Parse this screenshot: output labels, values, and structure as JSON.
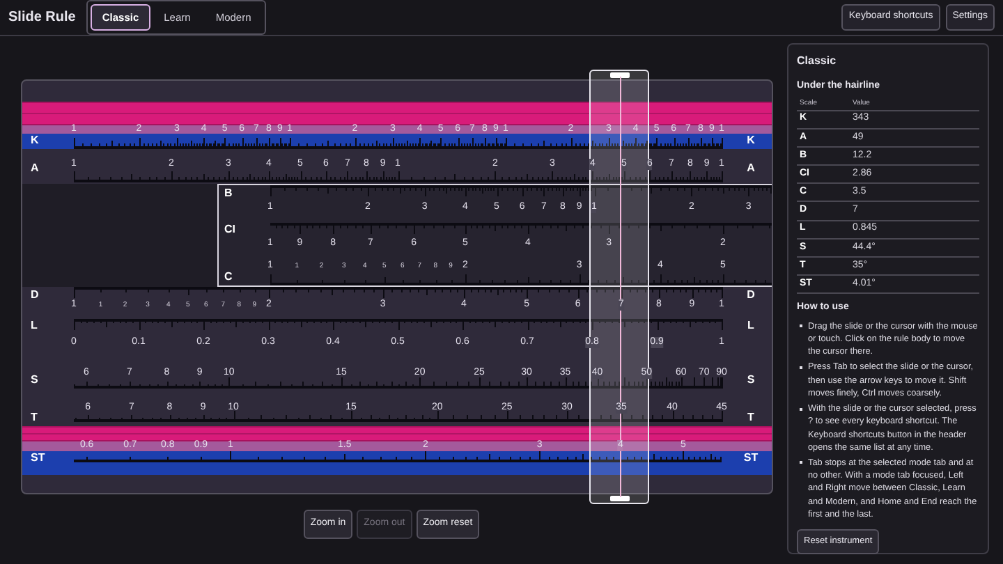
{
  "app": {
    "title": "Slide Rule"
  },
  "mode_tabs": [
    {
      "label": "Classic",
      "selected": true
    },
    {
      "label": "Learn",
      "selected": false
    },
    {
      "label": "Modern",
      "selected": false
    }
  ],
  "header_buttons": [
    "Keyboard shortcuts",
    "Settings"
  ],
  "rule": {
    "stator_top": [
      {
        "name": "K",
        "name_right": "K",
        "kind": "cube",
        "labels": [
          "1",
          "2",
          "3",
          "4",
          "5",
          "6",
          "7",
          "8",
          "9",
          "1",
          "2",
          "3",
          "4",
          "5",
          "6",
          "7",
          "8",
          "9",
          "1",
          "2",
          "3",
          "4",
          "5",
          "6",
          "7",
          "8",
          "9",
          "1"
        ]
      },
      {
        "name": "A",
        "name_right": "A",
        "kind": "square",
        "labels": [
          "1",
          "2",
          "3",
          "4",
          "5",
          "6",
          "7",
          "8",
          "9",
          "1",
          "2",
          "3",
          "4",
          "5",
          "6",
          "7",
          "8",
          "9",
          "1"
        ]
      }
    ],
    "slide": {
      "level": 0.301,
      "scales": [
        {
          "name": "B",
          "kind": "square",
          "labels": [
            "1",
            "2",
            "3",
            "4",
            "5",
            "6",
            "7",
            "8",
            "9",
            "1",
            "2",
            "3"
          ]
        },
        {
          "name": "CI",
          "kind": "inverse",
          "labels": [
            "1",
            "9",
            "8",
            "7",
            "6",
            "5",
            "4",
            "3",
            "2"
          ]
        },
        {
          "name": "C",
          "kind": "single",
          "labels": [
            "1",
            "2",
            "3",
            "4",
            "5"
          ],
          "minor_labels": [
            "1",
            "2",
            "3",
            "4",
            "5",
            "6",
            "7",
            "8",
            "9"
          ]
        }
      ]
    },
    "stator_bottom": [
      {
        "name": "D",
        "name_right": "D",
        "kind": "single",
        "labels": [
          "1",
          "2",
          "3",
          "4",
          "5",
          "6",
          "7",
          "8",
          "9",
          "1"
        ],
        "minor_labels": [
          "1",
          "2",
          "3",
          "4",
          "5",
          "6",
          "7",
          "8",
          "9"
        ]
      },
      {
        "name": "L",
        "name_right": "L",
        "kind": "linear",
        "labels": [
          "0",
          "0.1",
          "0.2",
          "0.3",
          "0.4",
          "0.5",
          "0.6",
          "0.7",
          "0.8",
          "0.9",
          "1"
        ]
      },
      {
        "name": "S",
        "name_right": "S",
        "kind": "sine",
        "labels": [
          "6",
          "7",
          "8",
          "9",
          "10",
          "15",
          "20",
          "25",
          "30",
          "35",
          "40",
          "50",
          "60",
          "70",
          "90"
        ]
      },
      {
        "name": "T",
        "name_right": "T",
        "kind": "tangent",
        "labels": [
          "6",
          "7",
          "8",
          "9",
          "10",
          "15",
          "20",
          "25",
          "30",
          "35",
          "40",
          "45"
        ]
      },
      {
        "name": "ST",
        "name_right": "ST",
        "kind": "small_tangent",
        "labels": [
          "0.6",
          "0.7",
          "0.8",
          "0.9",
          "1",
          "1.5",
          "2",
          "3",
          "4",
          "5"
        ]
      }
    ],
    "cursor": {
      "level": 0.845
    }
  },
  "zoom_buttons": [
    {
      "label": "Zoom in",
      "disabled": false
    },
    {
      "label": "Zoom out",
      "disabled": true
    },
    {
      "label": "Zoom reset",
      "disabled": false
    }
  ],
  "panel": {
    "title": "Classic",
    "readout": {
      "title": "Under the hairline",
      "columns": [
        "Scale",
        "Value"
      ],
      "rows": [
        [
          "K",
          "343"
        ],
        [
          "A",
          "49"
        ],
        [
          "B",
          "12.2"
        ],
        [
          "CI",
          "2.86"
        ],
        [
          "C",
          "3.5"
        ],
        [
          "D",
          "7"
        ],
        [
          "L",
          "0.845"
        ],
        [
          "S",
          "44.4°"
        ],
        [
          "T",
          "35°"
        ],
        [
          "ST",
          "4.01°"
        ]
      ]
    },
    "help": {
      "title": "How to use",
      "items": [
        "Drag the slide or the cursor with the mouse or touch. Click on the rule body to move the cursor there.",
        "Press Tab to select the slide or the cursor, then use the arrow keys to move it. Shift moves finely, Ctrl moves coarsely.",
        "With the slide or the cursor selected, press ? to see every keyboard shortcut. The Keyboard shortcuts button in the header opens the same list at any time.",
        "Tab stops at the selected mode tab and at no other. With a mode tab focused, Left and Right move between Classic, Learn and Modern, and Home and End reach the first and the last."
      ]
    },
    "reset_button": "Reset instrument"
  }
}
